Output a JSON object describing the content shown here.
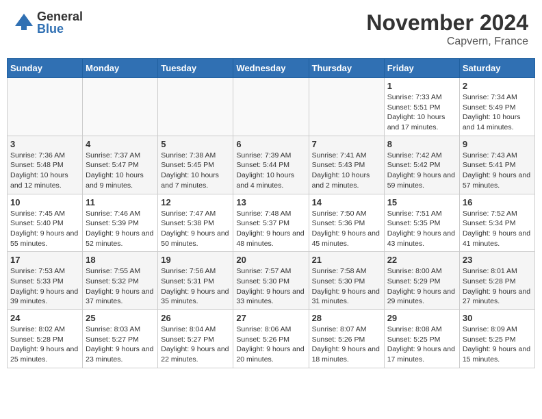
{
  "header": {
    "logo_general": "General",
    "logo_blue": "Blue",
    "month_title": "November 2024",
    "location": "Capvern, France"
  },
  "days_of_week": [
    "Sunday",
    "Monday",
    "Tuesday",
    "Wednesday",
    "Thursday",
    "Friday",
    "Saturday"
  ],
  "weeks": [
    {
      "days": [
        {
          "date": "",
          "empty": true
        },
        {
          "date": "",
          "empty": true
        },
        {
          "date": "",
          "empty": true
        },
        {
          "date": "",
          "empty": true
        },
        {
          "date": "",
          "empty": true
        },
        {
          "date": "1",
          "sunrise": "Sunrise: 7:33 AM",
          "sunset": "Sunset: 5:51 PM",
          "daylight": "Daylight: 10 hours and 17 minutes."
        },
        {
          "date": "2",
          "sunrise": "Sunrise: 7:34 AM",
          "sunset": "Sunset: 5:49 PM",
          "daylight": "Daylight: 10 hours and 14 minutes."
        }
      ]
    },
    {
      "days": [
        {
          "date": "3",
          "sunrise": "Sunrise: 7:36 AM",
          "sunset": "Sunset: 5:48 PM",
          "daylight": "Daylight: 10 hours and 12 minutes."
        },
        {
          "date": "4",
          "sunrise": "Sunrise: 7:37 AM",
          "sunset": "Sunset: 5:47 PM",
          "daylight": "Daylight: 10 hours and 9 minutes."
        },
        {
          "date": "5",
          "sunrise": "Sunrise: 7:38 AM",
          "sunset": "Sunset: 5:45 PM",
          "daylight": "Daylight: 10 hours and 7 minutes."
        },
        {
          "date": "6",
          "sunrise": "Sunrise: 7:39 AM",
          "sunset": "Sunset: 5:44 PM",
          "daylight": "Daylight: 10 hours and 4 minutes."
        },
        {
          "date": "7",
          "sunrise": "Sunrise: 7:41 AM",
          "sunset": "Sunset: 5:43 PM",
          "daylight": "Daylight: 10 hours and 2 minutes."
        },
        {
          "date": "8",
          "sunrise": "Sunrise: 7:42 AM",
          "sunset": "Sunset: 5:42 PM",
          "daylight": "Daylight: 9 hours and 59 minutes."
        },
        {
          "date": "9",
          "sunrise": "Sunrise: 7:43 AM",
          "sunset": "Sunset: 5:41 PM",
          "daylight": "Daylight: 9 hours and 57 minutes."
        }
      ]
    },
    {
      "days": [
        {
          "date": "10",
          "sunrise": "Sunrise: 7:45 AM",
          "sunset": "Sunset: 5:40 PM",
          "daylight": "Daylight: 9 hours and 55 minutes."
        },
        {
          "date": "11",
          "sunrise": "Sunrise: 7:46 AM",
          "sunset": "Sunset: 5:39 PM",
          "daylight": "Daylight: 9 hours and 52 minutes."
        },
        {
          "date": "12",
          "sunrise": "Sunrise: 7:47 AM",
          "sunset": "Sunset: 5:38 PM",
          "daylight": "Daylight: 9 hours and 50 minutes."
        },
        {
          "date": "13",
          "sunrise": "Sunrise: 7:48 AM",
          "sunset": "Sunset: 5:37 PM",
          "daylight": "Daylight: 9 hours and 48 minutes."
        },
        {
          "date": "14",
          "sunrise": "Sunrise: 7:50 AM",
          "sunset": "Sunset: 5:36 PM",
          "daylight": "Daylight: 9 hours and 45 minutes."
        },
        {
          "date": "15",
          "sunrise": "Sunrise: 7:51 AM",
          "sunset": "Sunset: 5:35 PM",
          "daylight": "Daylight: 9 hours and 43 minutes."
        },
        {
          "date": "16",
          "sunrise": "Sunrise: 7:52 AM",
          "sunset": "Sunset: 5:34 PM",
          "daylight": "Daylight: 9 hours and 41 minutes."
        }
      ]
    },
    {
      "days": [
        {
          "date": "17",
          "sunrise": "Sunrise: 7:53 AM",
          "sunset": "Sunset: 5:33 PM",
          "daylight": "Daylight: 9 hours and 39 minutes."
        },
        {
          "date": "18",
          "sunrise": "Sunrise: 7:55 AM",
          "sunset": "Sunset: 5:32 PM",
          "daylight": "Daylight: 9 hours and 37 minutes."
        },
        {
          "date": "19",
          "sunrise": "Sunrise: 7:56 AM",
          "sunset": "Sunset: 5:31 PM",
          "daylight": "Daylight: 9 hours and 35 minutes."
        },
        {
          "date": "20",
          "sunrise": "Sunrise: 7:57 AM",
          "sunset": "Sunset: 5:30 PM",
          "daylight": "Daylight: 9 hours and 33 minutes."
        },
        {
          "date": "21",
          "sunrise": "Sunrise: 7:58 AM",
          "sunset": "Sunset: 5:30 PM",
          "daylight": "Daylight: 9 hours and 31 minutes."
        },
        {
          "date": "22",
          "sunrise": "Sunrise: 8:00 AM",
          "sunset": "Sunset: 5:29 PM",
          "daylight": "Daylight: 9 hours and 29 minutes."
        },
        {
          "date": "23",
          "sunrise": "Sunrise: 8:01 AM",
          "sunset": "Sunset: 5:28 PM",
          "daylight": "Daylight: 9 hours and 27 minutes."
        }
      ]
    },
    {
      "days": [
        {
          "date": "24",
          "sunrise": "Sunrise: 8:02 AM",
          "sunset": "Sunset: 5:28 PM",
          "daylight": "Daylight: 9 hours and 25 minutes."
        },
        {
          "date": "25",
          "sunrise": "Sunrise: 8:03 AM",
          "sunset": "Sunset: 5:27 PM",
          "daylight": "Daylight: 9 hours and 23 minutes."
        },
        {
          "date": "26",
          "sunrise": "Sunrise: 8:04 AM",
          "sunset": "Sunset: 5:27 PM",
          "daylight": "Daylight: 9 hours and 22 minutes."
        },
        {
          "date": "27",
          "sunrise": "Sunrise: 8:06 AM",
          "sunset": "Sunset: 5:26 PM",
          "daylight": "Daylight: 9 hours and 20 minutes."
        },
        {
          "date": "28",
          "sunrise": "Sunrise: 8:07 AM",
          "sunset": "Sunset: 5:26 PM",
          "daylight": "Daylight: 9 hours and 18 minutes."
        },
        {
          "date": "29",
          "sunrise": "Sunrise: 8:08 AM",
          "sunset": "Sunset: 5:25 PM",
          "daylight": "Daylight: 9 hours and 17 minutes."
        },
        {
          "date": "30",
          "sunrise": "Sunrise: 8:09 AM",
          "sunset": "Sunset: 5:25 PM",
          "daylight": "Daylight: 9 hours and 15 minutes."
        }
      ]
    }
  ]
}
